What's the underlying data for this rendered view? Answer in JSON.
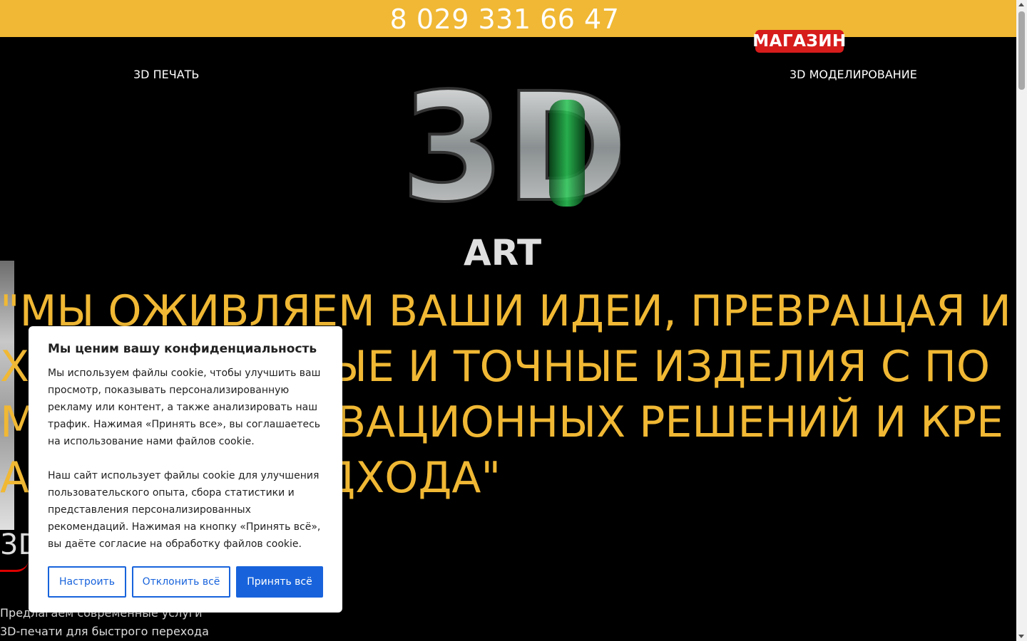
{
  "header": {
    "phone": "8 029 331 66 47"
  },
  "nav": {
    "print": "3D ПЕЧАТЬ",
    "modeling": "3D МОДЕЛИРОВАНИЕ",
    "shop": "МАГАЗИН"
  },
  "logo": {
    "main": "3D",
    "sub": "ART"
  },
  "hero": {
    "text": "\"МЫ ОЖИВЛЯЕМ ВАШИ ИДЕИ, ПРЕВРАЩАЯ ИХ В УНИКАЛЬНЫЕ И ТОЧНЫЕ ИЗДЕЛИЯ С ПОМОЩЬЮ ИННОВАЦИОННЫХ РЕШЕНИЙ И КРЕАТИВНОГО ПОДХОДА\"",
    "brand": "3D",
    "description": "Предлагаем современные услуги 3D-печати для быстрого перехода"
  },
  "cookie": {
    "title": "Мы ценим вашу конфиденциальность",
    "text1": "Мы используем файлы cookie, чтобы улучшить ваш просмотр, показывать персонализированную рекламу или контент, а также анализировать наш трафик. Нажимая «Принять все», вы соглашаетесь на использование нами файлов cookie.",
    "text2": "Наш сайт использует файлы cookie для улучшения пользовательского опыта, сбора статистики и представления персонализированных рекомендаций. Нажимая на кнопку «Принять всё», вы даёте согласие на обработку файлов cookie.",
    "customize": "Настроить",
    "reject": "Отклонить всё",
    "accept": "Принять всё"
  },
  "colors": {
    "accent": "#f0b834",
    "shop": "#d71c1c",
    "button": "#1863dc"
  }
}
